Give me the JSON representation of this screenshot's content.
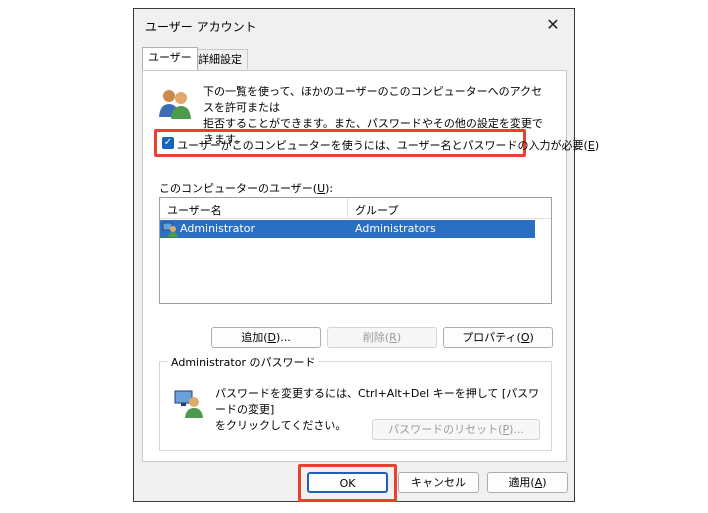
{
  "window": {
    "title": "ユーザー アカウント",
    "close_glyph": "✕"
  },
  "tabs": [
    {
      "label": "ユーザー"
    },
    {
      "label": "詳細設定"
    }
  ],
  "intro": {
    "line1": "下の一覧を使って、ほかのユーザーのこのコンピューターへのアクセスを許可または",
    "line2": "拒否することができます。また、パスワードやその他の設定を変更できます。"
  },
  "require_password": {
    "label": "ユーザーがこのコンピューターを使うには、ユーザー名とパスワードの入力が必要(",
    "mnemonic": "E",
    "close": ")",
    "checked": true
  },
  "users_list": {
    "label": "このコンピューターのユーザー(",
    "mnemonic": "U",
    "label_end": "):",
    "columns": [
      "ユーザー名",
      "グループ"
    ],
    "rows": [
      {
        "name": "Administrator",
        "group": "Administrators",
        "selected": true
      }
    ]
  },
  "user_buttons": {
    "add": {
      "text": "追加(",
      "mnemonic": "D",
      "end": ")..."
    },
    "remove": {
      "text": "削除(",
      "mnemonic": "R",
      "end": ")"
    },
    "properties": {
      "text": "プロパティ(",
      "mnemonic": "O",
      "end": ")"
    }
  },
  "password_group": {
    "title": "Administrator のパスワード",
    "line1": "パスワードを変更するには、Ctrl+Alt+Del キーを押して [パスワードの変更]",
    "line2": "をクリックしてください。",
    "reset_button": {
      "text": "パスワードのリセット(",
      "mnemonic": "P",
      "end": ")..."
    }
  },
  "footer": {
    "ok": "OK",
    "cancel": "キャンセル",
    "apply": {
      "text": "適用(",
      "mnemonic": "A",
      "end": ")"
    }
  },
  "colors": {
    "highlight": "#e8412f",
    "selection": "#2a6fc1",
    "checkbox": "#1565c0"
  }
}
